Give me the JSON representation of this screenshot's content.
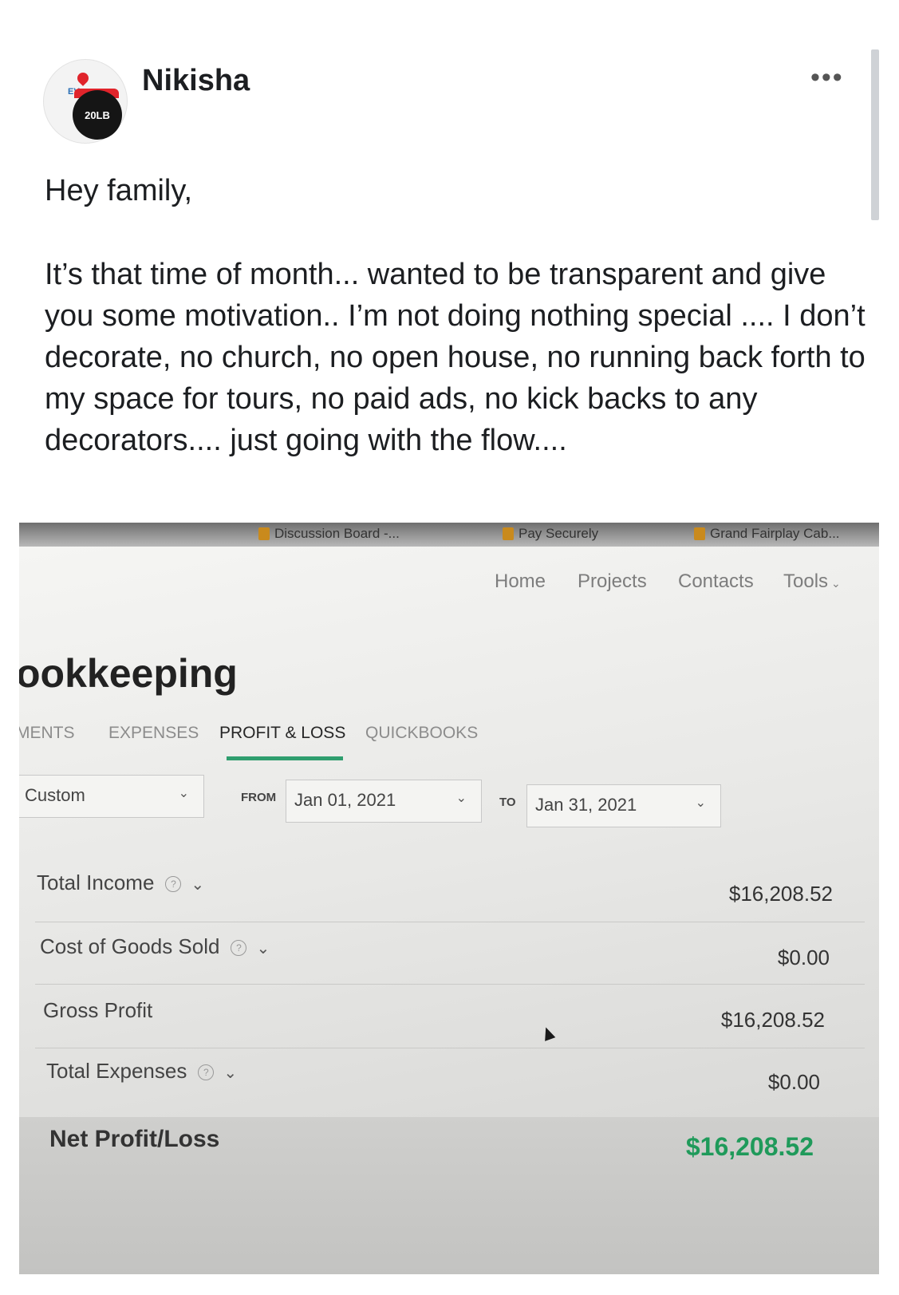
{
  "post": {
    "author": "Nikisha",
    "avatar_text": "20LB",
    "greeting": "Hey family,",
    "body": "It’s that time of month... wanted to be transparent and give you some motivation.. I’m not doing nothing special .... I don’t decorate, no church, no open house, no running back forth to my space for tours, no paid ads, no kick backs to any decorators.... just going with the flow....",
    "more_icon": "more-options-icon"
  },
  "photo": {
    "bookmarks": [
      "Discussion Board -...",
      "Pay Securely",
      "Grand Fairplay Cab..."
    ],
    "nav": [
      "Home",
      "Projects",
      "Contacts",
      "Tools"
    ],
    "page_title": "ookkeeping",
    "tabs": [
      "MENTS",
      "EXPENSES",
      "PROFIT & LOSS",
      "QUICKBOOKS"
    ],
    "active_tab": "PROFIT & LOSS",
    "filters": {
      "range": "Custom",
      "from_label": "FROM",
      "from": "Jan 01, 2021",
      "to_label": "TO",
      "to": "Jan 31, 2021"
    },
    "rows": [
      {
        "label": "Total Income",
        "value": "$16,208.52"
      },
      {
        "label": "Cost of Goods Sold",
        "value": "$0.00"
      },
      {
        "label": "Gross Profit",
        "value": "$16,208.52"
      },
      {
        "label": "Total Expenses",
        "value": "$0.00"
      }
    ],
    "net": {
      "label": "Net Profit/Loss",
      "value": "$16,208.52"
    },
    "colors": {
      "accent": "#2f9e6e",
      "net_value": "#1f9a5a"
    }
  }
}
